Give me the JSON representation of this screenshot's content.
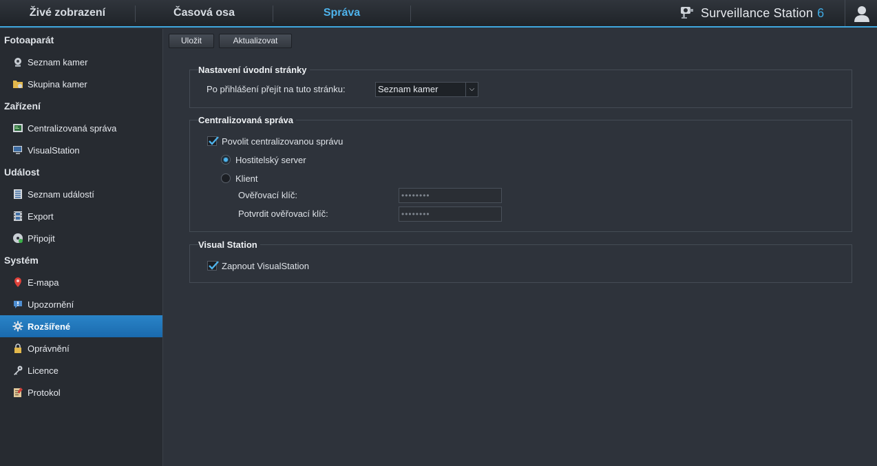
{
  "nav": {
    "tabs": [
      {
        "label": "Živé zobrazení"
      },
      {
        "label": "Časová osa"
      },
      {
        "label": "Správa"
      }
    ],
    "brand": {
      "name": "Surveillance Station",
      "version": "6"
    }
  },
  "sidebar": {
    "sections": [
      {
        "title": "Fotoaparát",
        "items": [
          {
            "label": "Seznam kamer"
          },
          {
            "label": "Skupina kamer"
          }
        ]
      },
      {
        "title": "Zařízení",
        "items": [
          {
            "label": "Centralizovaná správa"
          },
          {
            "label": "VisualStation"
          }
        ]
      },
      {
        "title": "Událost",
        "items": [
          {
            "label": "Seznam událostí"
          },
          {
            "label": "Export"
          },
          {
            "label": "Připojit"
          }
        ]
      },
      {
        "title": "Systém",
        "items": [
          {
            "label": "E-mapa"
          },
          {
            "label": "Upozornění"
          },
          {
            "label": "Rozšířené"
          },
          {
            "label": "Oprávnění"
          },
          {
            "label": "Licence"
          },
          {
            "label": "Protokol"
          }
        ]
      }
    ]
  },
  "toolbar": {
    "save_label": "Uložit",
    "refresh_label": "Aktualizovat"
  },
  "homepage": {
    "legend": "Nastavení úvodní stránky",
    "label": "Po přihlášení přejít na tuto stránku:",
    "selected": "Seznam kamer"
  },
  "central": {
    "legend": "Centralizovaná správa",
    "enable_label": "Povolit centralizovanou správu",
    "enable_checked": true,
    "host_label": "Hostitelský server",
    "client_label": "Klient",
    "mode": "host",
    "key_label": "Ověřovací klíč:",
    "key_value": "••••••••",
    "confirm_label": "Potvrdit ověřovací klíč:",
    "confirm_value": "••••••••"
  },
  "visual": {
    "legend": "Visual Station",
    "enable_label": "Zapnout VisualStation",
    "enable_checked": true
  },
  "colors": {
    "accent": "#3fa8e0",
    "active_item": "#1f74b8"
  }
}
